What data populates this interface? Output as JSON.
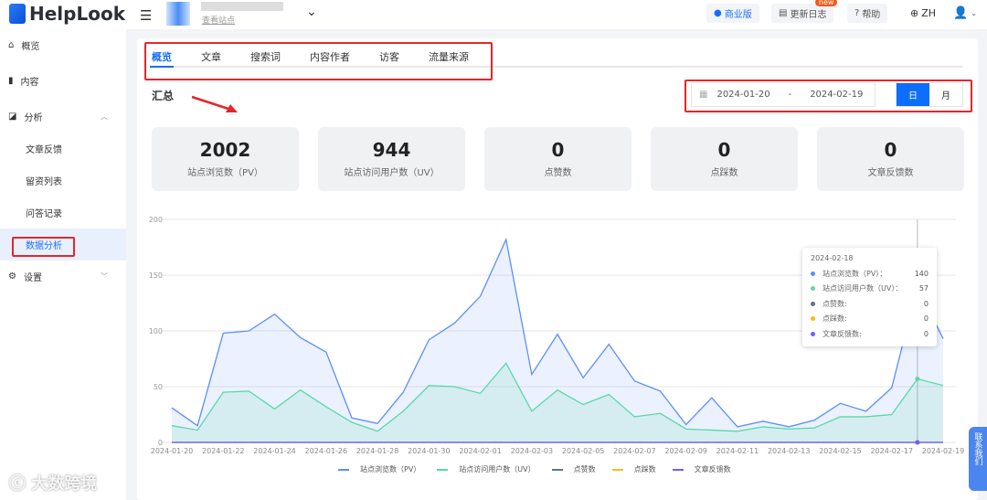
{
  "header": {
    "brand": "HelpLook",
    "site_link": "查看站点",
    "business": "商业版",
    "changelog": "更新日志",
    "new_badge": "new",
    "help": "帮助",
    "lang": "ZH"
  },
  "sidebar": {
    "items": [
      {
        "label": "概览"
      },
      {
        "label": "内容"
      },
      {
        "label": "分析"
      },
      {
        "label": "文章反馈"
      },
      {
        "label": "留资列表"
      },
      {
        "label": "问答记录"
      },
      {
        "label": "数据分析"
      },
      {
        "label": "设置"
      }
    ]
  },
  "tabs": [
    "概览",
    "文章",
    "搜索词",
    "内容作者",
    "访客",
    "流量来源"
  ],
  "summary_title": "汇总",
  "date_range": {
    "start": "2024-01-20",
    "sep": "-",
    "end": "2024-02-19"
  },
  "granularity": {
    "day": "日",
    "month": "月",
    "selected": "日"
  },
  "cards": [
    {
      "value": "2002",
      "label": "站点浏览数（PV）"
    },
    {
      "value": "944",
      "label": "站点访问用户数（UV）"
    },
    {
      "value": "0",
      "label": "点赞数"
    },
    {
      "value": "0",
      "label": "点踩数"
    },
    {
      "value": "0",
      "label": "文章反馈数"
    }
  ],
  "tooltip": {
    "date": "2024-02-18",
    "rows": [
      {
        "label": "站点浏览数（PV）：",
        "value": "140",
        "color": "#5b8ff9"
      },
      {
        "label": "站点访问用户数（UV）：",
        "value": "57",
        "color": "#5ad8a6"
      },
      {
        "label": "点赞数:",
        "value": "0",
        "color": "#5d7092"
      },
      {
        "label": "点踩数:",
        "value": "0",
        "color": "#f6bd16"
      },
      {
        "label": "文章反馈数:",
        "value": "0",
        "color": "#6f5ef9"
      }
    ]
  },
  "float_button": "联系我们",
  "watermark": "大数跨境",
  "chart_data": {
    "type": "area",
    "ylim": [
      0,
      200
    ],
    "yticks": [
      0,
      50,
      100,
      150,
      200
    ],
    "x": [
      "2024-01-20",
      "2024-01-21",
      "2024-01-22",
      "2024-01-23",
      "2024-01-24",
      "2024-01-25",
      "2024-01-26",
      "2024-01-27",
      "2024-01-28",
      "2024-01-29",
      "2024-01-30",
      "2024-01-31",
      "2024-02-01",
      "2024-02-02",
      "2024-02-03",
      "2024-02-04",
      "2024-02-05",
      "2024-02-06",
      "2024-02-07",
      "2024-02-08",
      "2024-02-09",
      "2024-02-10",
      "2024-02-11",
      "2024-02-12",
      "2024-02-13",
      "2024-02-14",
      "2024-02-15",
      "2024-02-16",
      "2024-02-17",
      "2024-02-18",
      "2024-02-19"
    ],
    "series": [
      {
        "name": "站点浏览数（PV）",
        "color": "#5b8ff9",
        "values": [
          31,
          15,
          98,
          100,
          115,
          94,
          81,
          22,
          17,
          45,
          92,
          107,
          131,
          182,
          61,
          97,
          58,
          88,
          55,
          46,
          16,
          40,
          14,
          19,
          14,
          20,
          35,
          28,
          49,
          140,
          93
        ]
      },
      {
        "name": "站点访问用户数（UV）",
        "color": "#5ad8a6",
        "values": [
          15,
          11,
          45,
          46,
          30,
          47,
          32,
          18,
          10,
          28,
          51,
          50,
          44,
          71,
          28,
          47,
          34,
          43,
          23,
          26,
          12,
          11,
          10,
          14,
          12,
          13,
          23,
          23,
          25,
          57,
          51
        ]
      },
      {
        "name": "点赞数",
        "color": "#5d7092",
        "values": [
          0,
          0,
          0,
          0,
          0,
          0,
          0,
          0,
          0,
          0,
          0,
          0,
          0,
          0,
          0,
          0,
          0,
          0,
          0,
          0,
          0,
          0,
          0,
          0,
          0,
          0,
          0,
          0,
          0,
          0,
          0
        ]
      },
      {
        "name": "点踩数",
        "color": "#f6bd16",
        "values": [
          0,
          0,
          0,
          0,
          0,
          0,
          0,
          0,
          0,
          0,
          0,
          0,
          0,
          0,
          0,
          0,
          0,
          0,
          0,
          0,
          0,
          0,
          0,
          0,
          0,
          0,
          0,
          0,
          0,
          0,
          0
        ]
      },
      {
        "name": "文章反馈数",
        "color": "#6f5ef9",
        "values": [
          0,
          0,
          0,
          0,
          0,
          0,
          0,
          0,
          0,
          0,
          0,
          0,
          0,
          0,
          0,
          0,
          0,
          0,
          0,
          0,
          0,
          0,
          0,
          0,
          0,
          0,
          0,
          0,
          0,
          0,
          0
        ]
      }
    ],
    "highlight": "2024-02-18",
    "legend": "bottom"
  }
}
